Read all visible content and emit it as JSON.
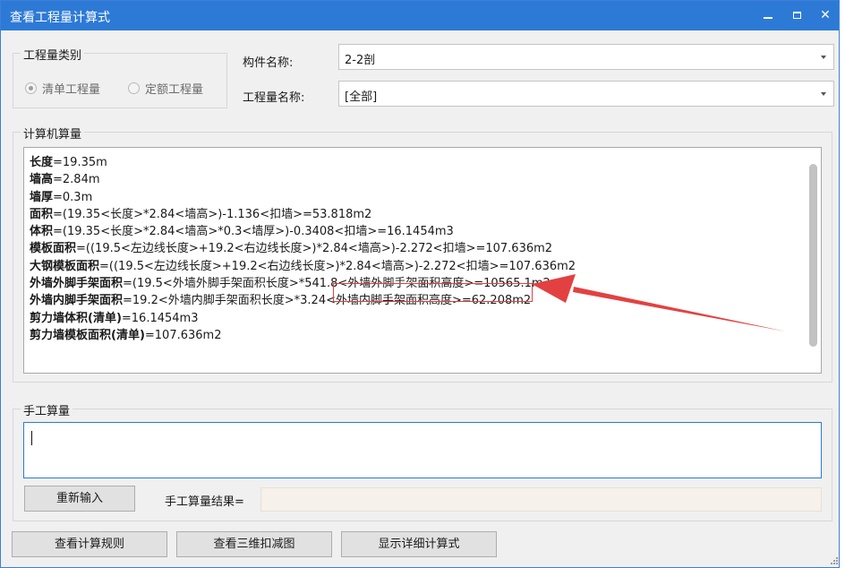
{
  "window": {
    "title": "查看工程量计算式",
    "controls": {
      "minimize": "minimize",
      "maximize": "maximize",
      "close": "✕"
    }
  },
  "quantity_type": {
    "group_label": "工程量类别",
    "options": [
      {
        "label": "清单工程量",
        "selected": true
      },
      {
        "label": "定额工程量",
        "selected": false
      }
    ]
  },
  "component": {
    "label": "构件名称:",
    "value": "2-2剖"
  },
  "quantity_name": {
    "label": "工程量名称:",
    "value": "[全部]"
  },
  "computer_calc": {
    "group_label": "计算机算量",
    "lines": [
      {
        "key": "长度",
        "expr": "=19.35m"
      },
      {
        "key": "墙高",
        "expr": "=2.84m"
      },
      {
        "key": "墙厚",
        "expr": "=0.3m"
      },
      {
        "key": "面积",
        "expr": "=(19.35<长度>*2.84<墙高>)-1.136<扣墙>=53.818m2"
      },
      {
        "key": "体积",
        "expr": "=(19.35<长度>*2.84<墙高>*0.3<墙厚>)-0.3408<扣墙>=16.1454m3"
      },
      {
        "key": "模板面积",
        "expr": "=((19.5<左边线长度>+19.2<右边线长度>)*2.84<墙高>)-2.272<扣墙>=107.636m2"
      },
      {
        "key": "大钢模板面积",
        "expr": "=((19.5<左边线长度>+19.2<右边线长度>)*2.84<墙高>)-2.272<扣墙>=107.636m2"
      },
      {
        "key": "外墙外脚手架面积",
        "expr": "=(19.5<外墙外脚手架面积长度>*541.8<外墙外脚手架面积高度>=10565.1m2"
      },
      {
        "key": "外墙内脚手架面积",
        "expr": "=19.2<外墙内脚手架面积长度>*3.24<外墙内脚手架面积高度>=62.208m2"
      },
      {
        "key": "剪力墙体积(清单)",
        "expr": "=16.1454m3"
      },
      {
        "key": "剪力墙模板面积(清单)",
        "expr": "=107.636m2"
      }
    ]
  },
  "manual_calc": {
    "group_label": "手工算量",
    "input_value": "",
    "reinput_button": "重新输入",
    "result_label": "手工算量结果=",
    "result_value": ""
  },
  "footer": {
    "buttons": [
      "查看计算规则",
      "查看三维扣减图",
      "显示详细计算式"
    ]
  },
  "colors": {
    "titlebar": "#2d7ad6",
    "annotation_red": "#e34141"
  },
  "icons": [
    "minimize-icon",
    "maximize-icon",
    "close-icon",
    "dropdown-arrow-icon",
    "resize-grip-icon"
  ]
}
